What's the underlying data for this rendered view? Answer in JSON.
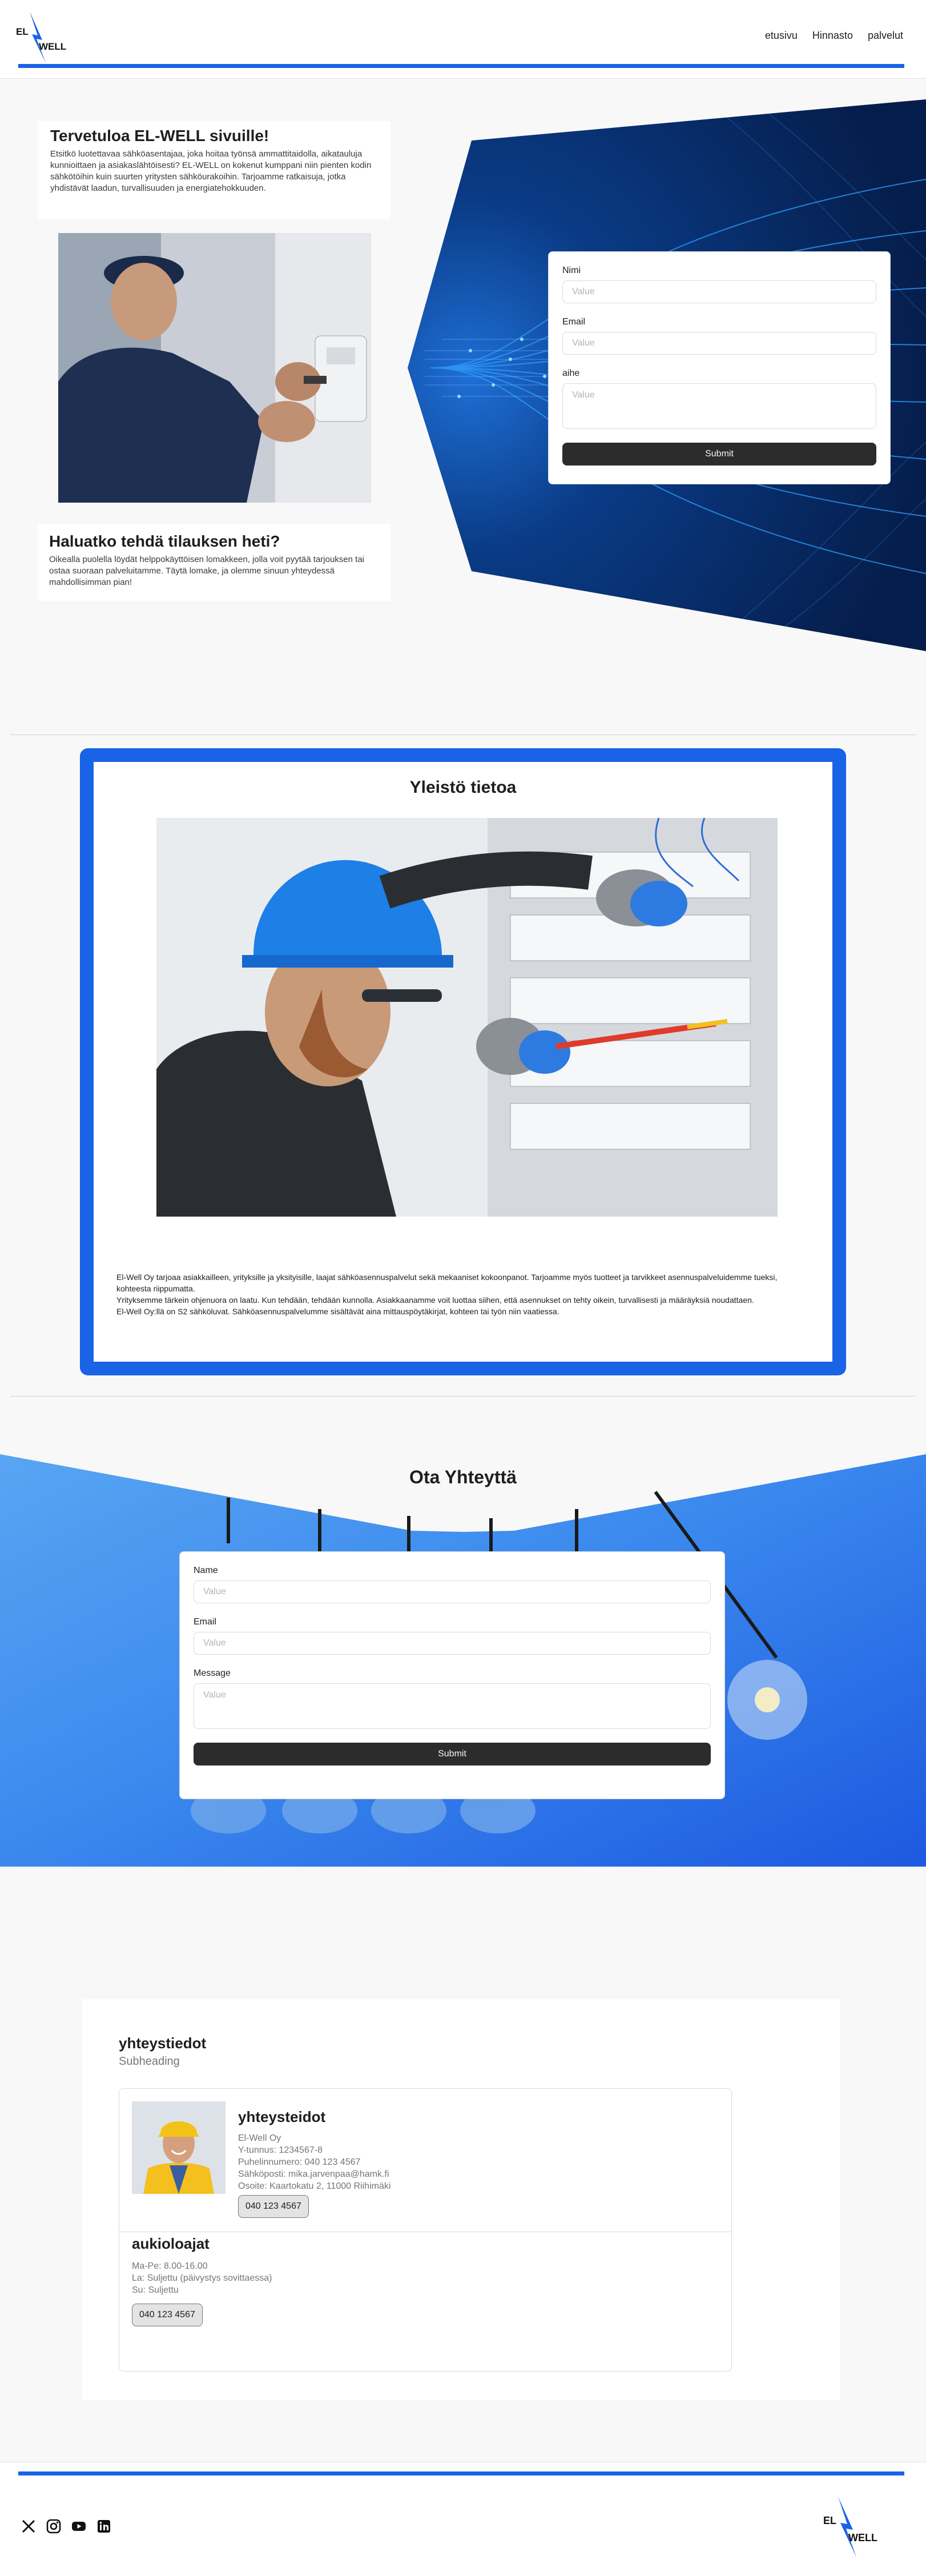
{
  "header": {
    "logo_el": "EL",
    "logo_well": "WELL",
    "nav": [
      "etusivu",
      "Hinnasto",
      "palvelut"
    ]
  },
  "hero": {
    "welcome_title": "Tervetuloa EL-WELL sivuille!",
    "welcome_text": "Etsitkö luotettavaa sähköasentajaa, joka hoitaa työnsä ammattitaidolla, aikatauluja kunnioittaen ja asiakaslähtöisesti? EL-WELL on kokenut kumppani niin pienten kodin sähkötöihin kuin suurten yritysten sähköurakoihin. Tarjoamme ratkaisuja, jotka yhdistävät laadun, turvallisuuden ja energiatehokkuuden.",
    "order_title": "Haluatko tehdä tilauksen heti?",
    "order_text": "Oikealla puolella löydät helppokäyttöisen lomakkeen, jolla voit pyytää tarjouksen tai ostaa suoraan palveluitamme. Täytä lomake, ja olemme sinuun yhteydessä mahdollisimman pian!",
    "form": {
      "name_label": "Nimi",
      "name_placeholder": "Value",
      "email_label": "Email",
      "email_placeholder": "Value",
      "subject_label": "aihe",
      "subject_placeholder": "Value",
      "submit": "Submit"
    }
  },
  "info": {
    "title": "Yleistö tietoa",
    "paragraphs": [
      "El-Well Oy tarjoaa asiakkailleen, yrityksille ja yksityisille, laajat sähköasennuspalvelut sekä mekaaniset kokoonpanot. Tarjoamme myös tuotteet ja tarvikkeet asennuspalveluidemme tueksi, kohteesta riippumatta.",
      "Yrityksemme tärkein ohjenuora on laatu. Kun tehdään, tehdään kunnolla. Asiakkaanamme voit luottaa siihen, että asennukset on tehty oikein, turvallisesti ja määräyksiä noudattaen.",
      "El-Well Oy:llä on S2 sähköluvat. Sähköasennuspalvelumme sisältävät aina mittauspöytäkirjat, kohteen tai työn niin vaatiessa."
    ]
  },
  "contact": {
    "title": "Ota Yhteyttä",
    "form": {
      "name_label": "Name",
      "name_placeholder": "Value",
      "email_label": "Email",
      "email_placeholder": "Value",
      "message_label": "Message",
      "message_placeholder": "Value",
      "submit": "Submit"
    }
  },
  "contact_info": {
    "heading": "yhteystiedot",
    "subheading": "Subheading",
    "card_title": "yhteysteidot",
    "lines": [
      "El-Well Oy",
      "Y-tunnus: 1234567-8",
      "Puhelinnumero: 040 123 4567",
      "Sähköposti: mika.jarvenpaa@hamk.fi",
      "Osoite: Kaartokatu 2, 11000 Riihimäki"
    ],
    "phone_button": "040 123 4567",
    "hours_title": "aukioloajat",
    "hours": [
      "Ma-Pe: 8.00-16.00",
      "La: Suljettu (päivystys sovittaessa)",
      "Su: Suljettu"
    ],
    "hours_button": "040 123 4567"
  },
  "footer": {
    "logo_el": "EL",
    "logo_well": "WELL",
    "socials": [
      "x-icon",
      "instagram-icon",
      "youtube-icon",
      "linkedin-icon"
    ]
  },
  "colors": {
    "accent": "#1863e6",
    "dark_button": "#2c2c2c",
    "hero_bg": "#06275e"
  }
}
